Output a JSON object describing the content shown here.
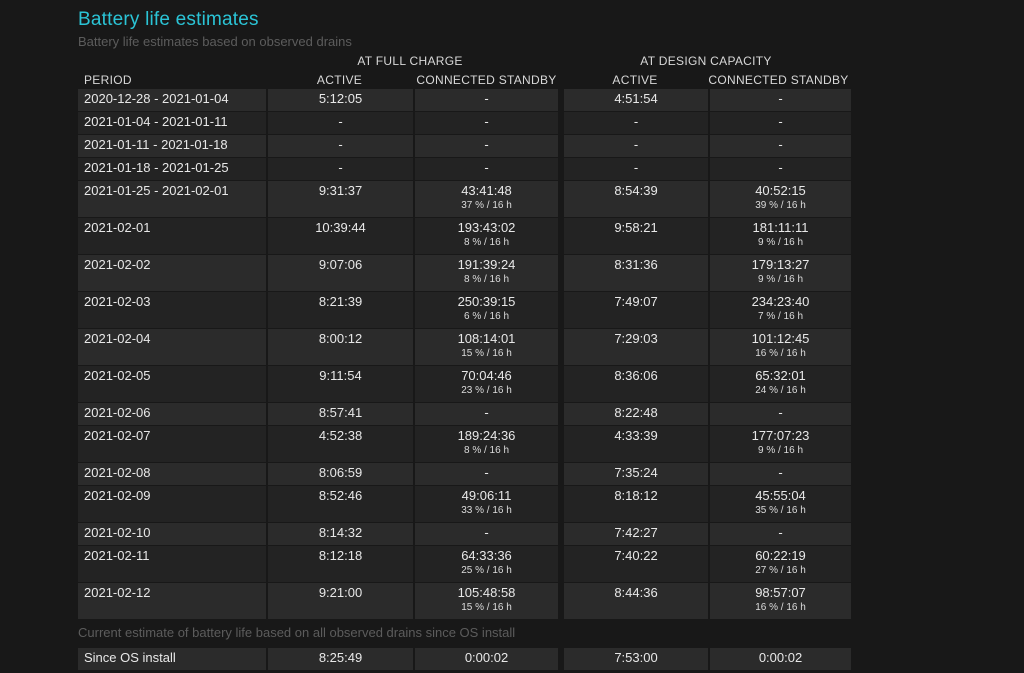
{
  "title": "Battery life estimates",
  "subtitle": "Battery life estimates based on observed drains",
  "group_headers": {
    "full": "AT FULL CHARGE",
    "design": "AT DESIGN CAPACITY"
  },
  "columns": {
    "period": "PERIOD",
    "active": "ACTIVE",
    "standby": "CONNECTED STANDBY"
  },
  "rows": [
    {
      "period": "2020-12-28 - 2021-01-04",
      "fa": "5:12:05",
      "fs": "-",
      "fs_sub": "",
      "da": "4:51:54",
      "ds": "-",
      "ds_sub": ""
    },
    {
      "period": "2021-01-04 - 2021-01-11",
      "fa": "-",
      "fs": "-",
      "fs_sub": "",
      "da": "-",
      "ds": "-",
      "ds_sub": ""
    },
    {
      "period": "2021-01-11 - 2021-01-18",
      "fa": "-",
      "fs": "-",
      "fs_sub": "",
      "da": "-",
      "ds": "-",
      "ds_sub": ""
    },
    {
      "period": "2021-01-18 - 2021-01-25",
      "fa": "-",
      "fs": "-",
      "fs_sub": "",
      "da": "-",
      "ds": "-",
      "ds_sub": ""
    },
    {
      "period": "2021-01-25 - 2021-02-01",
      "fa": "9:31:37",
      "fs": "43:41:48",
      "fs_sub": "37 % / 16 h",
      "da": "8:54:39",
      "ds": "40:52:15",
      "ds_sub": "39 % / 16 h"
    },
    {
      "period": "2021-02-01",
      "fa": "10:39:44",
      "fs": "193:43:02",
      "fs_sub": "8 % / 16 h",
      "da": "9:58:21",
      "ds": "181:11:11",
      "ds_sub": "9 % / 16 h"
    },
    {
      "period": "2021-02-02",
      "fa": "9:07:06",
      "fs": "191:39:24",
      "fs_sub": "8 % / 16 h",
      "da": "8:31:36",
      "ds": "179:13:27",
      "ds_sub": "9 % / 16 h"
    },
    {
      "period": "2021-02-03",
      "fa": "8:21:39",
      "fs": "250:39:15",
      "fs_sub": "6 % / 16 h",
      "da": "7:49:07",
      "ds": "234:23:40",
      "ds_sub": "7 % / 16 h"
    },
    {
      "period": "2021-02-04",
      "fa": "8:00:12",
      "fs": "108:14:01",
      "fs_sub": "15 % / 16 h",
      "da": "7:29:03",
      "ds": "101:12:45",
      "ds_sub": "16 % / 16 h"
    },
    {
      "period": "2021-02-05",
      "fa": "9:11:54",
      "fs": "70:04:46",
      "fs_sub": "23 % / 16 h",
      "da": "8:36:06",
      "ds": "65:32:01",
      "ds_sub": "24 % / 16 h"
    },
    {
      "period": "2021-02-06",
      "fa": "8:57:41",
      "fs": "-",
      "fs_sub": "",
      "da": "8:22:48",
      "ds": "-",
      "ds_sub": ""
    },
    {
      "period": "2021-02-07",
      "fa": "4:52:38",
      "fs": "189:24:36",
      "fs_sub": "8 % / 16 h",
      "da": "4:33:39",
      "ds": "177:07:23",
      "ds_sub": "9 % / 16 h"
    },
    {
      "period": "2021-02-08",
      "fa": "8:06:59",
      "fs": "-",
      "fs_sub": "",
      "da": "7:35:24",
      "ds": "-",
      "ds_sub": ""
    },
    {
      "period": "2021-02-09",
      "fa": "8:52:46",
      "fs": "49:06:11",
      "fs_sub": "33 % / 16 h",
      "da": "8:18:12",
      "ds": "45:55:04",
      "ds_sub": "35 % / 16 h"
    },
    {
      "period": "2021-02-10",
      "fa": "8:14:32",
      "fs": "-",
      "fs_sub": "",
      "da": "7:42:27",
      "ds": "-",
      "ds_sub": ""
    },
    {
      "period": "2021-02-11",
      "fa": "8:12:18",
      "fs": "64:33:36",
      "fs_sub": "25 % / 16 h",
      "da": "7:40:22",
      "ds": "60:22:19",
      "ds_sub": "27 % / 16 h"
    },
    {
      "period": "2021-02-12",
      "fa": "9:21:00",
      "fs": "105:48:58",
      "fs_sub": "15 % / 16 h",
      "da": "8:44:36",
      "ds": "98:57:07",
      "ds_sub": "16 % / 16 h"
    }
  ],
  "os_note": "Current estimate of battery life based on all observed drains since OS install",
  "os_row": {
    "period": "Since OS install",
    "fa": "8:25:49",
    "fs": "0:00:02",
    "da": "7:53:00",
    "ds": "0:00:02"
  },
  "colors": {
    "title": "#2bc4d6",
    "background": "#181818",
    "row_odd": "#2b2b2b",
    "row_even": "#232323",
    "muted": "#5c5c5c"
  }
}
